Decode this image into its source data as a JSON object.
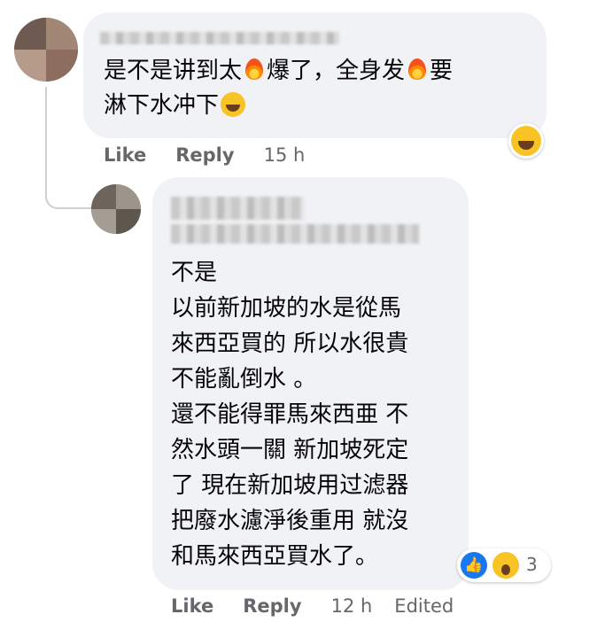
{
  "comment1": {
    "text_line1_a": "是不是讲到太",
    "text_line1_b": "爆了，全身发",
    "text_line1_c": "要",
    "text_line2": "淋下水冲下",
    "actions": {
      "like": "Like",
      "reply": "Reply",
      "time": "15 h"
    }
  },
  "comment2": {
    "text": "不是\n以前新加坡的水是從馬\n來西亞買的 所以水很貴\n不能亂倒水 。\n還不能得罪馬來西亜 不\n然水頭一關 新加坡死定\n了 現在新加坡用过滤器\n把廢水濾淨後重用 就沒\n和馬來西亞買水了。",
    "reaction_count": "3",
    "actions": {
      "like": "Like",
      "reply": "Reply",
      "time": "12 h",
      "edited": "Edited"
    }
  },
  "icons": {
    "fire": "fire-emoji-icon",
    "laugh": "laughing-emoji-icon",
    "haha_reaction": "haha-reaction-icon",
    "like_reaction": "like-reaction-icon",
    "wow_reaction": "wow-reaction-icon"
  },
  "colors": {
    "bubble": "#f0f2f5",
    "meta_text": "#65676b",
    "like_blue": "#1877f2",
    "emoji_yellow": "#f7c325"
  }
}
